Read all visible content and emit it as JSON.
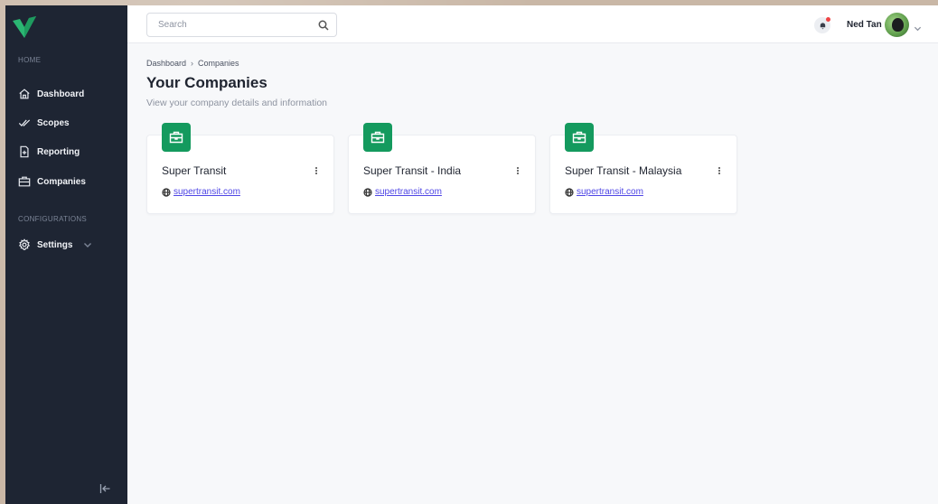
{
  "sidebar": {
    "sections": [
      {
        "label": "HOME"
      },
      {
        "label": "CONFIGURATIONS"
      }
    ],
    "items": [
      {
        "label": "Dashboard",
        "icon": "home-icon"
      },
      {
        "label": "Scopes",
        "icon": "double-check-icon"
      },
      {
        "label": "Reporting",
        "icon": "report-file-icon"
      },
      {
        "label": "Companies",
        "icon": "briefcase-icon"
      },
      {
        "label": "Settings",
        "icon": "gear-icon"
      }
    ],
    "brand_color": "#2bb673"
  },
  "topbar": {
    "search_placeholder": "Search",
    "user_name": "Ned Tan",
    "notification_dot_color": "#ef4444"
  },
  "breadcrumb": {
    "items": [
      "Dashboard",
      "Companies"
    ]
  },
  "page": {
    "title": "Your Companies",
    "subtitle": "View your company details and information"
  },
  "companies": [
    {
      "name": "Super Transit",
      "website": "supertransit.com"
    },
    {
      "name": "Super Transit - India",
      "website": "supertransit.com"
    },
    {
      "name": "Super Transit - Malaysia",
      "website": "supertransit.com"
    }
  ],
  "colors": {
    "sidebar_bg": "#1e2533",
    "card_icon_bg": "#149a5e",
    "link": "#4f46e5"
  }
}
